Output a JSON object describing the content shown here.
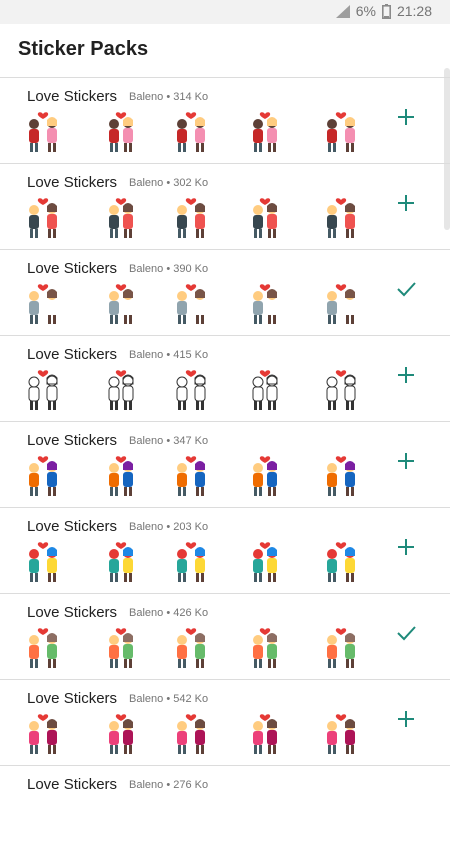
{
  "status_bar": {
    "battery": "6%",
    "time": "21:28",
    "icons": [
      "signal-icon",
      "battery-icon"
    ]
  },
  "app_bar": {
    "title": "Sticker Packs"
  },
  "accent_color": "#1e8a7a",
  "packs": [
    {
      "name": "Love Stickers",
      "author": "Baleno",
      "size": "314 Ko",
      "action": "add-icon"
    },
    {
      "name": "Love Stickers",
      "author": "Baleno",
      "size": "302 Ko",
      "action": "add-icon"
    },
    {
      "name": "Love Stickers",
      "author": "Baleno",
      "size": "390 Ko",
      "action": "check-icon"
    },
    {
      "name": "Love Stickers",
      "author": "Baleno",
      "size": "415 Ko",
      "action": "add-icon"
    },
    {
      "name": "Love Stickers",
      "author": "Baleno",
      "size": "347 Ko",
      "action": "add-icon"
    },
    {
      "name": "Love Stickers",
      "author": "Baleno",
      "size": "203 Ko",
      "action": "add-icon"
    },
    {
      "name": "Love Stickers",
      "author": "Baleno",
      "size": "426 Ko",
      "action": "check-icon"
    },
    {
      "name": "Love Stickers",
      "author": "Baleno",
      "size": "542 Ko",
      "action": "add-icon"
    },
    {
      "name": "Love Stickers",
      "author": "Baleno",
      "size": "276 Ko",
      "action": ""
    }
  ]
}
